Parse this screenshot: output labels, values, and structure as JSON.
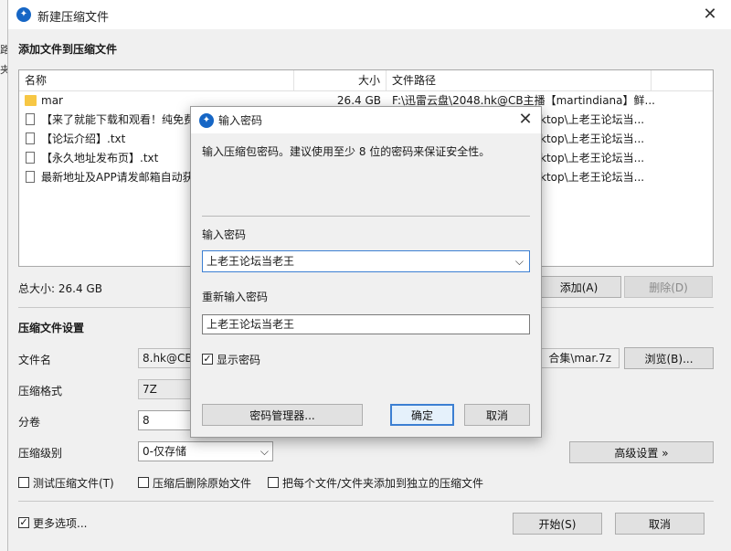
{
  "main_window": {
    "title": "新建压缩文件",
    "section_add_files": "添加文件到压缩文件",
    "columns": {
      "name": "名称",
      "size": "大小",
      "path": "文件路径"
    },
    "files": [
      {
        "name": "mar",
        "size": "26.4 GB",
        "path": "F:\\迅雷云盘\\2048.hk@CB主播【martindiana】鲜...",
        "type": "folder"
      },
      {
        "name": "【来了就能下载和观看！纯免费",
        "size": "",
        "path": "ktop\\上老王论坛当...",
        "type": "file"
      },
      {
        "name": "【论坛介绍】.txt",
        "size": "",
        "path": "ktop\\上老王论坛当...",
        "type": "file"
      },
      {
        "name": "【永久地址发布页】.txt",
        "size": "",
        "path": "ktop\\上老王论坛当...",
        "type": "file"
      },
      {
        "name": "最新地址及APP请发邮箱自动获",
        "size": "",
        "path": "ktop\\上老王论坛当...",
        "type": "file"
      }
    ],
    "total_size": "总大小: 26.4 GB",
    "add_button": "添加(A)",
    "delete_button": "删除(D)",
    "section_settings": "压缩文件设置",
    "filename_label": "文件名",
    "filename_value": "8.hk@CB主",
    "filename_value_end": "合集\\mar.7z",
    "browse_button": "浏览(B)...",
    "format_label": "压缩格式",
    "format_value": "7Z",
    "volume_label": "分卷",
    "volume_value": "8",
    "level_label": "压缩级别",
    "level_value": "0-仅存储",
    "advanced_button": "高级设置 »",
    "test_checkbox": "测试压缩文件(T)",
    "delete_after_checkbox": "压缩后删除原始文件",
    "separate_checkbox": "把每个文件/文件夹添加到独立的压缩文件",
    "more_options_checkbox": "更多选项...",
    "more_options_checked": "✓",
    "start_button": "开始(S)",
    "cancel_button": "取消",
    "left_edge_chars": [
      "路",
      "夹"
    ]
  },
  "password_dialog": {
    "title": "输入密码",
    "instruction": "输入压缩包密码。建议使用至少 8 位的密码来保证安全性。",
    "password_label": "输入密码",
    "password_value": "上老王论坛当老王",
    "reenter_label": "重新输入密码",
    "reenter_value": "上老王论坛当老王",
    "show_password": "显示密码",
    "show_password_checked": "✓",
    "manager_button": "密码管理器...",
    "ok_button": "确定",
    "cancel_button": "取消"
  },
  "icons": {
    "app": "app-logo-icon",
    "close": "×",
    "chevron": "⌵"
  },
  "colors": {
    "accent": "#3c7fd2",
    "folder": "#f7c744",
    "app_logo": "#1666c5"
  }
}
